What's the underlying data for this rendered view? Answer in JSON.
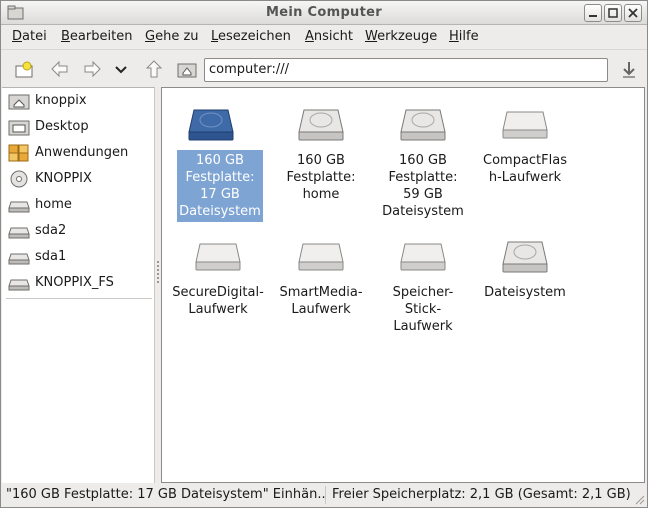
{
  "window": {
    "title": "Mein Computer"
  },
  "menu": [
    {
      "u": "D",
      "rest": "atei"
    },
    {
      "u": "B",
      "rest": "earbeiten"
    },
    {
      "u": "G",
      "rest": "ehe zu"
    },
    {
      "u": "L",
      "rest": "esezeichen"
    },
    {
      "u": "A",
      "rest": "nsicht"
    },
    {
      "u": "W",
      "rest": "erkzeuge"
    },
    {
      "u": "H",
      "rest": "ilfe"
    }
  ],
  "toolbar": {
    "location_value": "computer:///",
    "icons": [
      "new-folder-icon",
      "back-icon",
      "forward-icon",
      "history-dropdown-icon",
      "up-icon",
      "home-icon",
      "go-icon"
    ]
  },
  "sidebar": {
    "items": [
      {
        "label": "knoppix",
        "icon": "home-folder-icon"
      },
      {
        "label": "Desktop",
        "icon": "desktop-icon"
      },
      {
        "label": "Anwendungen",
        "icon": "applications-icon"
      },
      {
        "label": "KNOPPIX",
        "icon": "cdrom-icon"
      },
      {
        "label": "home",
        "icon": "drive-icon"
      },
      {
        "label": "sda2",
        "icon": "drive-icon"
      },
      {
        "label": "sda1",
        "icon": "drive-icon"
      },
      {
        "label": "KNOPPIX_FS",
        "icon": "drive-icon"
      }
    ]
  },
  "main": {
    "items": [
      {
        "label": "160 GB\nFestplatte:\n17 GB\nDateisystem",
        "icon": "harddisk-icon",
        "selected": true
      },
      {
        "label": "160 GB\nFestplatte:\nhome",
        "icon": "harddisk-icon",
        "selected": false
      },
      {
        "label": "160 GB\nFestplatte:\n59 GB\nDateisystem",
        "icon": "harddisk-icon",
        "selected": false
      },
      {
        "label": "CompactFlas\nh-Laufwerk",
        "icon": "removable-drive-icon",
        "selected": false
      },
      {
        "label": "SecureDigital-\nLaufwerk",
        "icon": "removable-drive-icon",
        "selected": false
      },
      {
        "label": "SmartMedia-\nLaufwerk",
        "icon": "removable-drive-icon",
        "selected": false
      },
      {
        "label": "Speicher-\nStick-\nLaufwerk",
        "icon": "removable-drive-icon",
        "selected": false
      },
      {
        "label": "Dateisystem",
        "icon": "harddisk-icon",
        "selected": false
      }
    ]
  },
  "status": {
    "left": "\"160 GB Festplatte: 17 GB Dateisystem\" Einhän...",
    "right": "Freier Speicherplatz: 2,1 GB (Gesamt: 2,1 GB)"
  },
  "colors": {
    "selection": "#7ea4d3",
    "selected_drive": "#3e6aa8"
  }
}
